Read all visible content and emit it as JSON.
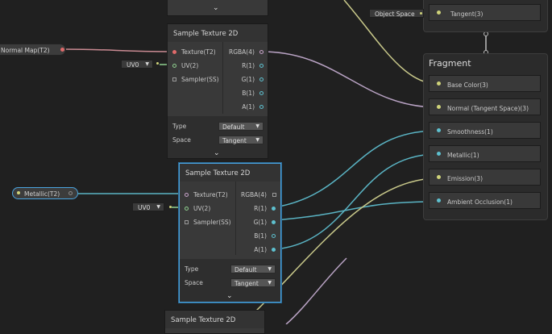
{
  "colors": {
    "background": "#202020",
    "node": "#393939",
    "selection": "#4aa3df",
    "wire_pink": "#c98a92",
    "wire_lavender": "#b9a3c4",
    "wire_yellow": "#c8c88a",
    "wire_teal": "#5ab4c4"
  },
  "top_node": {
    "chevron": "⌄"
  },
  "node1": {
    "title": "Sample Texture 2D",
    "inputs": [
      "Texture(T2)",
      "UV(2)",
      "Sampler(SS)"
    ],
    "outputs": [
      "RGBA(4)",
      "R(1)",
      "G(1)",
      "B(1)",
      "A(1)"
    ],
    "type_label": "Type",
    "type_value": "Default",
    "space_label": "Space",
    "space_value": "Tangent"
  },
  "node2": {
    "title": "Sample Texture 2D",
    "inputs": [
      "Texture(T2)",
      "UV(2)",
      "Sampler(SS)"
    ],
    "outputs": [
      "RGBA(4)",
      "R(1)",
      "G(1)",
      "B(1)",
      "A(1)"
    ],
    "type_label": "Type",
    "type_value": "Default",
    "space_label": "Space",
    "space_value": "Tangent"
  },
  "node3": {
    "title": "Sample Texture 2D"
  },
  "normal_map_property": "Normal Map(T2)",
  "metallic_property": "Metallic(T2)",
  "uv_field_1": "UV0",
  "uv_field_2": "UV0",
  "object_space_field": "Object Space",
  "tangent_block": "Tangent(3)",
  "fragment": {
    "title": "Fragment",
    "blocks": [
      "Base Color(3)",
      "Normal (Tangent Space)(3)",
      "Smoothness(1)",
      "Metallic(1)",
      "Emission(3)",
      "Ambient Occlusion(1)"
    ]
  }
}
